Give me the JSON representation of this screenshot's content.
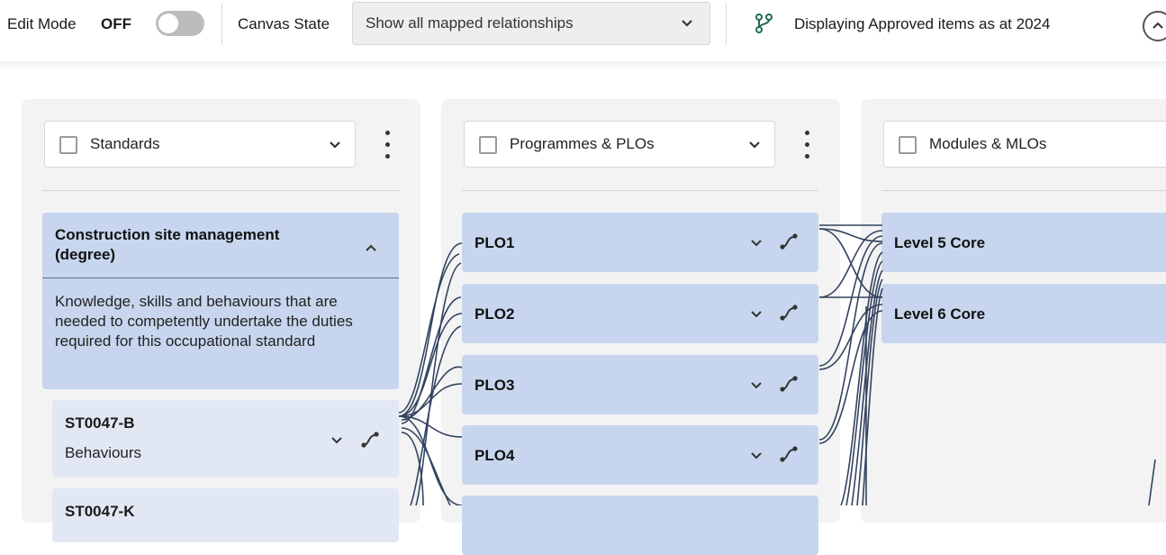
{
  "toolbar": {
    "edit_mode_label": "Edit Mode",
    "edit_mode_state": "OFF",
    "canvas_state_label": "Canvas State",
    "canvas_state_value": "Show all mapped relationships",
    "display_icon": "branch-icon",
    "display_text": "Displaying Approved items as at 2024"
  },
  "colors": {
    "card": "#c7d6ee",
    "subcard": "#e2e8f3",
    "link": "#1e3050",
    "toggle_off": "#bcbcbc",
    "branch_icon": "#1f6b4f"
  },
  "columns": [
    {
      "title": "Standards",
      "group": {
        "title": "Construction site management (degree)",
        "description": "Knowledge, skills and behaviours that are needed to competently undertake the duties required for this occupational standard"
      },
      "items": [
        {
          "code": "ST0047-B",
          "label": "Behaviours"
        },
        {
          "code": "ST0047-K",
          "label": ""
        }
      ]
    },
    {
      "title": "Programmes & PLOs",
      "items": [
        "PLO1",
        "PLO2",
        "PLO3",
        "PLO4",
        ""
      ]
    },
    {
      "title": "Modules & MLOs",
      "items": [
        "Level 5 Core",
        "Level 6 Core"
      ]
    }
  ]
}
